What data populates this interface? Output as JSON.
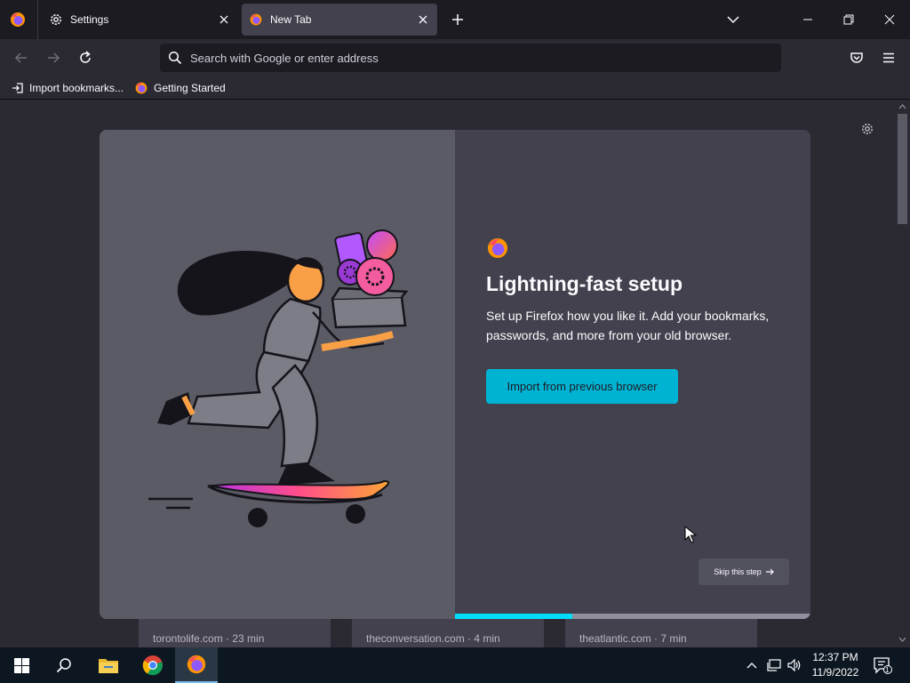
{
  "tabs": [
    {
      "label": "Settings",
      "icon": "gear-icon",
      "active": false
    },
    {
      "label": "New Tab",
      "icon": "firefox-icon",
      "active": true
    }
  ],
  "urlbar": {
    "placeholder": "Search with Google or enter address"
  },
  "bookmarks": [
    {
      "label": "Import bookmarks...",
      "icon": "import-icon"
    },
    {
      "label": "Getting Started",
      "icon": "firefox-icon"
    }
  ],
  "onboarding": {
    "title": "Lightning-fast setup",
    "subtitle": "Set up Firefox how you like it. Add your bookmarks, passwords, and more from your old browser.",
    "import_button": "Import from previous browser",
    "skip_button": "Skip this step",
    "progress": 0.33
  },
  "stories": [
    {
      "source": "torontolife.com · 23 min"
    },
    {
      "source": "theconversation.com · 4 min"
    },
    {
      "source": "theatlantic.com · 7 min"
    }
  ],
  "taskbar": {
    "time": "12:37 PM",
    "date": "11/9/2022",
    "notification_count": "1"
  },
  "colors": {
    "accent": "#00b3d3",
    "progress": "#00ddff",
    "chrome_bg": "#1c1b22",
    "toolbar_bg": "#2b2a33"
  }
}
